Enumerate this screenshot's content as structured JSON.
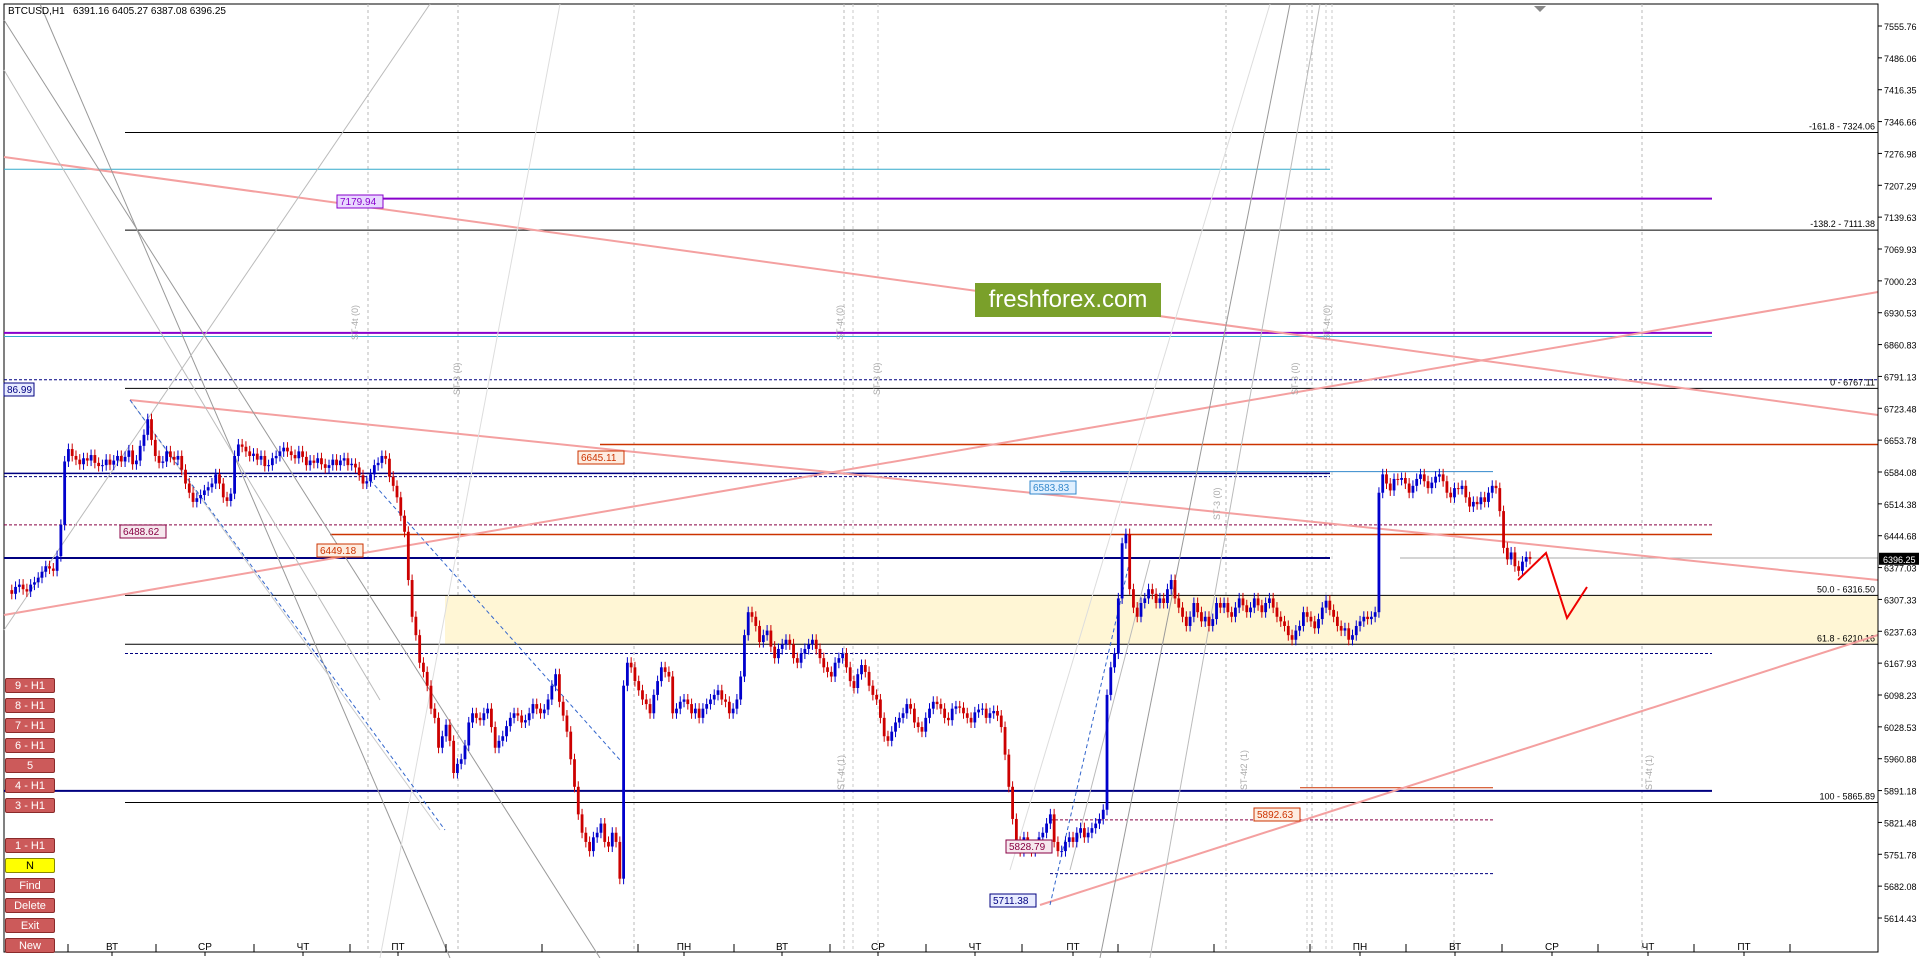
{
  "chart_header": {
    "symbol": "BTCUSD,H1",
    "ohlc": "6391.16 6405.27 6387.08 6396.25"
  },
  "watermark": "freshforex.com",
  "current_price": "6396.25",
  "price_axis": [
    "7555.76",
    "7486.06",
    "7416.35",
    "7346.66",
    "7276.98",
    "7207.29",
    "7139.63",
    "7069.93",
    "7000.23",
    "6930.53",
    "6860.83",
    "6791.13",
    "6723.48",
    "6653.78",
    "6584.08",
    "6514.38",
    "6444.68",
    "6377.03",
    "6307.33",
    "6237.63",
    "6167.93",
    "6098.23",
    "6028.53",
    "5960.88",
    "5891.18",
    "5821.48",
    "5751.78",
    "5682.08",
    "5614.43"
  ],
  "time_axis": [
    "ВТ",
    "СР",
    "ЧТ",
    "ПТ",
    "ПН",
    "ВТ",
    "СР",
    "ЧТ",
    "ПТ",
    "ПН",
    "ВТ",
    "СР",
    "ЧТ",
    "ПТ"
  ],
  "fib_labels": [
    "-161.8 - 7324.06",
    "-138.2 - 7111.38",
    "0 - 6767.11",
    "50.0 - 6316.50",
    "61.8 - 6210.16",
    "100 - 5865.89"
  ],
  "price_tags": [
    "7179.94",
    "6645.11",
    "6488.62",
    "6449.18",
    "6583.83",
    "5892.63",
    "5828.79",
    "5711.38",
    "86.99"
  ],
  "side_buttons": [
    "9 - H1",
    "8 - H1",
    "7 - H1",
    "6 - H1",
    "5",
    "4 - H1",
    "3 - H1",
    "1 - H1",
    "N",
    "Find",
    "Delete",
    "Exit",
    "New"
  ],
  "cycle_labels": [
    "ST-4t (0)",
    "ST-3 (0)",
    "ST-4t (0)",
    "ST-3 (0)",
    "ST-3 (0)",
    "ST-4t (0)",
    "ST-3 (0)",
    "ST-4t (1)",
    "ST-4t2 (1)",
    "ST-4t (1)"
  ],
  "colors": {
    "bull": "#0000cc",
    "bear": "#cc0000",
    "fib": "#000000",
    "zone": "#fff6d5",
    "pink": "#f4a0a0",
    "navy": "#000080",
    "purple": "#8800cc",
    "orange": "#cc3300",
    "forecast": "#ee0000"
  },
  "candles": [
    6328,
    6320,
    6335,
    6340,
    6330,
    6325,
    6340,
    6345,
    6355,
    6368,
    6380,
    6375,
    6370,
    6402,
    6470,
    6608,
    6635,
    6620,
    6612,
    6602,
    6615,
    6610,
    6622,
    6605,
    6598,
    6600,
    6612,
    6601,
    6610,
    6620,
    6608,
    6618,
    6632,
    6602,
    6610,
    6642,
    6666,
    6700,
    6655,
    6620,
    6605,
    6608,
    6630,
    6618,
    6612,
    6620,
    6590,
    6560,
    6540,
    6520,
    6528,
    6535,
    6545,
    6552,
    6560,
    6580,
    6560,
    6530,
    6522,
    6538,
    6620,
    6645,
    6640,
    6630,
    6620,
    6625,
    6612,
    6620,
    6598,
    6600,
    6615,
    6620,
    6630,
    6638,
    6630,
    6622,
    6615,
    6630,
    6618,
    6600,
    6610,
    6605,
    6615,
    6602,
    6594,
    6600,
    6612,
    6600,
    6610,
    6615,
    6600,
    6603,
    6595,
    6578,
    6560,
    6565,
    6580,
    6600,
    6605,
    6620,
    6614,
    6575,
    6555,
    6530,
    6490,
    6455,
    6350,
    6270,
    6230,
    6170,
    6150,
    6120,
    6070,
    6050,
    5985,
    6010,
    6035,
    6000,
    5930,
    5950,
    5960,
    5990,
    6040,
    6060,
    6050,
    6045,
    6060,
    6070,
    6030,
    5985,
    6000,
    6010,
    6032,
    6050,
    6060,
    6055,
    6040,
    6045,
    6060,
    6080,
    6070,
    6060,
    6068,
    6090,
    6120,
    6145,
    6085,
    6055,
    6020,
    5960,
    5900,
    5840,
    5800,
    5780,
    5760,
    5790,
    5800,
    5820,
    5780,
    5770,
    5800,
    5780,
    5700,
    6120,
    6170,
    6160,
    6130,
    6110,
    6090,
    6080,
    6060,
    6100,
    6130,
    6160,
    6150,
    6140,
    6060,
    6070,
    6085,
    6090,
    6080,
    6060,
    6070,
    6050,
    6070,
    6080,
    6090,
    6100,
    6110,
    6090,
    6085,
    6060,
    6070,
    6090,
    6140,
    6230,
    6280,
    6270,
    6250,
    6215,
    6230,
    6240,
    6205,
    6180,
    6200,
    6210,
    6220,
    6210,
    6180,
    6170,
    6190,
    6200,
    6210,
    6220,
    6200,
    6180,
    6160,
    6150,
    6140,
    6170,
    6180,
    6190,
    6160,
    6130,
    6115,
    6145,
    6165,
    6150,
    6120,
    6100,
    6090,
    6050,
    6010,
    6000,
    6020,
    6040,
    6050,
    6060,
    6080,
    6070,
    6040,
    6030,
    6020,
    6050,
    6070,
    6085,
    6080,
    6070,
    6050,
    6045,
    6070,
    6075,
    6072,
    6060,
    6050,
    6040,
    6062,
    6068,
    6070,
    6050,
    6060,
    6065,
    6055,
    6030,
    5970,
    5900,
    5830,
    5780,
    5760,
    5790,
    5770,
    5760,
    5770,
    5790,
    5800,
    5820,
    5840,
    5780,
    5760,
    5760,
    5780,
    5790,
    5780,
    5800,
    5810,
    5790,
    5800,
    5810,
    5820,
    5830,
    5850,
    6100,
    6160,
    6190,
    6310,
    6430,
    6450,
    6330,
    6290,
    6270,
    6300,
    6310,
    6330,
    6320,
    6300,
    6310,
    6300,
    6330,
    6350,
    6310,
    6290,
    6270,
    6250,
    6270,
    6300,
    6280,
    6260,
    6270,
    6250,
    6265,
    6300,
    6290,
    6300,
    6280,
    6270,
    6290,
    6310,
    6295,
    6280,
    6290,
    6310,
    6295,
    6280,
    6300,
    6310,
    6290,
    6270,
    6260,
    6250,
    6230,
    6220,
    6240,
    6250,
    6280,
    6270,
    6260,
    6245,
    6265,
    6290,
    6305,
    6285,
    6270,
    6250,
    6240,
    6245,
    6220,
    6230,
    6250,
    6260,
    6270,
    6265,
    6270,
    6280,
    6540,
    6580,
    6560,
    6545,
    6570,
    6568,
    6572,
    6560,
    6540,
    6555,
    6570,
    6580,
    6565,
    6550,
    6562,
    6575,
    6580,
    6565,
    6540,
    6530,
    6550,
    6548,
    6555,
    6530,
    6510,
    6520,
    6515,
    6530,
    6520,
    6540,
    6555,
    6550,
    6500,
    6420,
    6395,
    6410,
    6380,
    6370,
    6390,
    6400,
    6396
  ]
}
